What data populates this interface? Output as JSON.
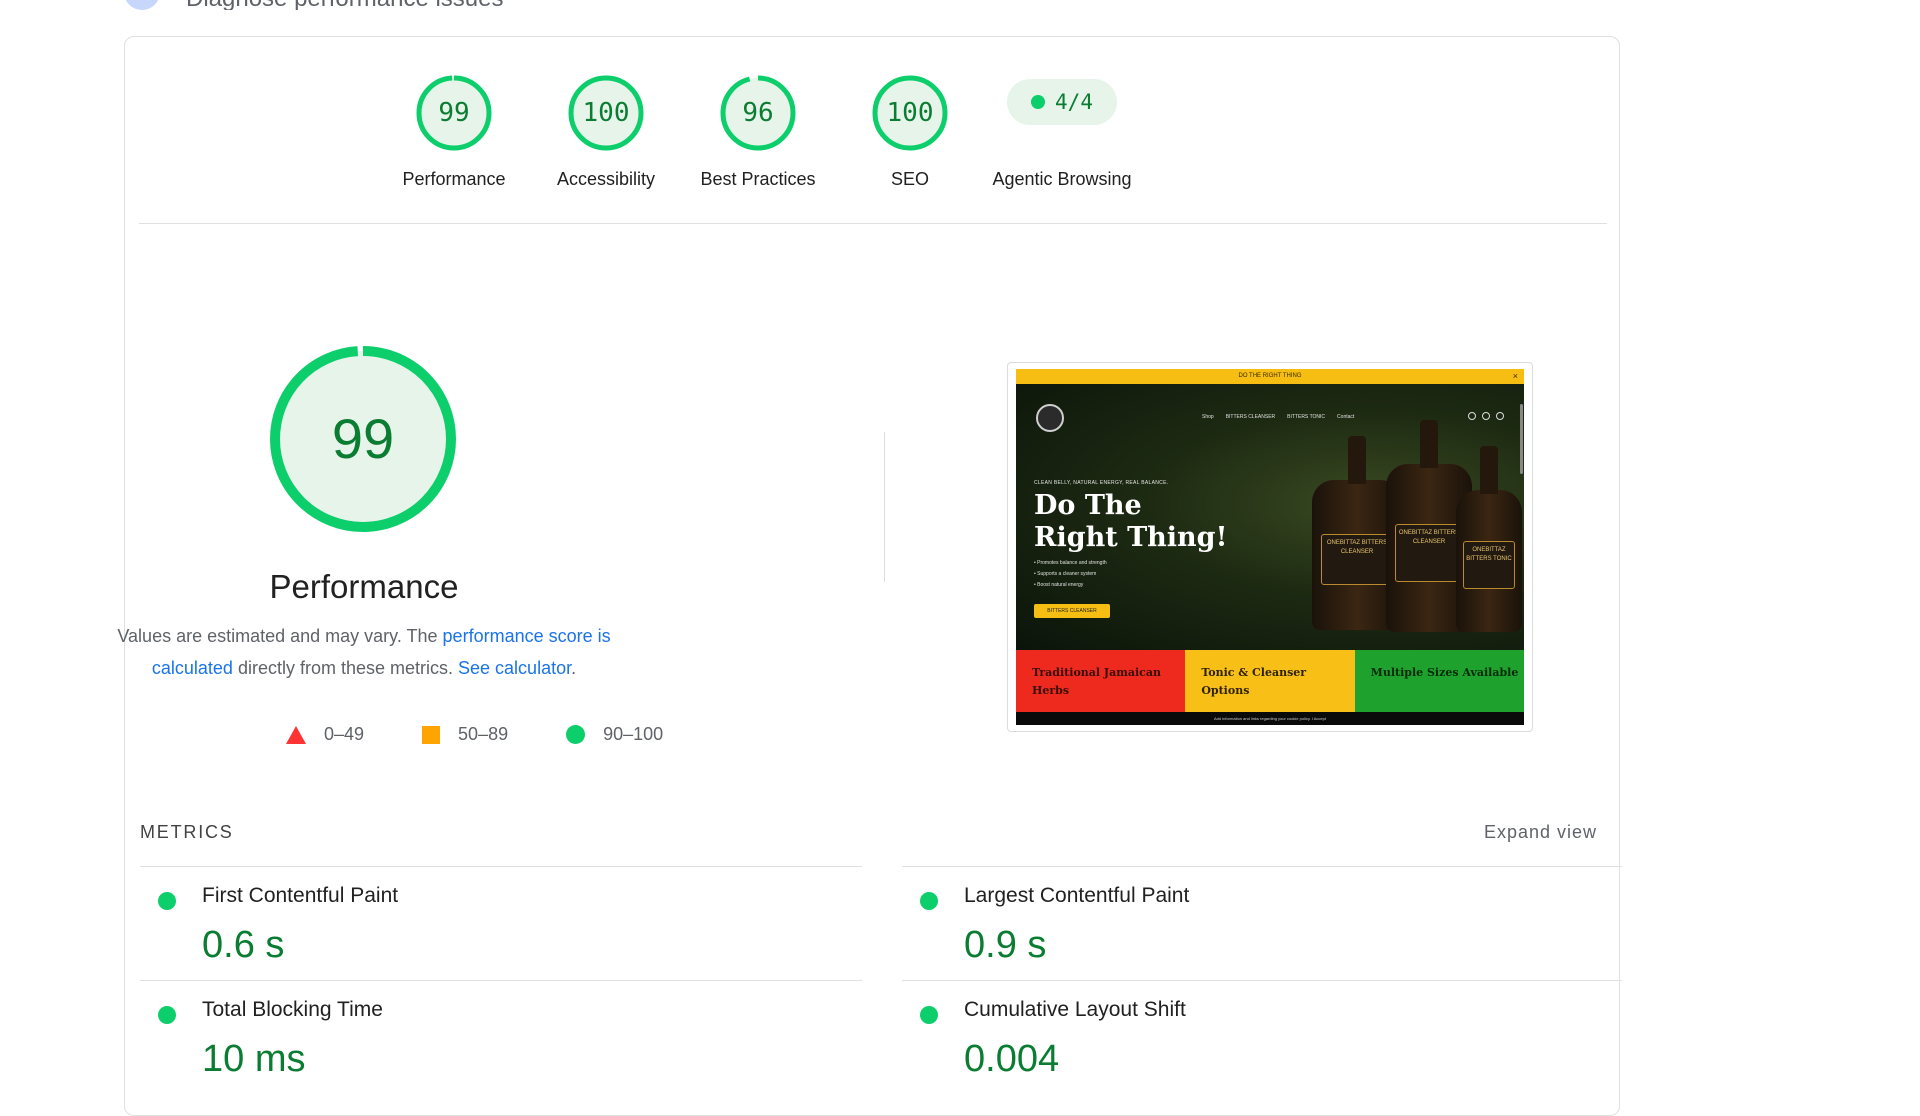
{
  "header": {
    "title": "Diagnose performance issues"
  },
  "colors": {
    "pass": "#0cce6b",
    "pass_text": "#0a7d32",
    "pass_bg": "#e6f4ea",
    "average": "#ffa400",
    "fail": "#ff3333",
    "link": "#1a73e8"
  },
  "gauges": [
    {
      "score": "99",
      "label": "Performance",
      "value": 99
    },
    {
      "score": "100",
      "label": "Accessibility",
      "value": 100
    },
    {
      "score": "96",
      "label": "Best Practices",
      "value": 96
    },
    {
      "score": "100",
      "label": "SEO",
      "value": 100
    }
  ],
  "agentic": {
    "score": "4/4",
    "label": "Agentic Browsing"
  },
  "performance": {
    "score": "99",
    "value": 99,
    "title": "Performance",
    "desc_prefix": "Values are estimated and may vary. The ",
    "link1": "performance score is calculated",
    "desc_middle": " directly from these metrics. ",
    "link2": "See calculator",
    "desc_suffix": "."
  },
  "legend": {
    "fail": "0–49",
    "average": "50–89",
    "pass": "90–100"
  },
  "screenshot": {
    "announcement": "DO THE RIGHT THING",
    "close": "×",
    "nav": [
      "Shop",
      "BITTERS CLEANSER",
      "BITTERS TONIC",
      "Contact"
    ],
    "eyebrow": "CLEAN BELLY, NATURAL ENERGY, REAL BALANCE.",
    "headline": "Do The Right Thing!",
    "bullets": [
      "• Promotes balance and strength",
      "• Supports a cleaner system",
      "• Boost natural energy"
    ],
    "cta": "BITTERS CLEANSER",
    "bottles": [
      "ONEBITTAZ BITTERS CLEANSER",
      "ONEBITTAZ BITTERS CLEANSER",
      "ONEBITTAZ BITTERS TONIC"
    ],
    "bands": [
      "Traditional Jamaican Herbs",
      "Tonic & Cleanser Options",
      "Multiple Sizes Available"
    ],
    "cookie": "Add information and links regarding your cookie policy.  I Accept"
  },
  "metrics": {
    "heading": "METRICS",
    "expand": "Expand view",
    "items": [
      {
        "name": "First Contentful Paint",
        "value": "0.6 s"
      },
      {
        "name": "Largest Contentful Paint",
        "value": "0.9 s"
      },
      {
        "name": "Total Blocking Time",
        "value": "10 ms"
      },
      {
        "name": "Cumulative Layout Shift",
        "value": "0.004"
      }
    ]
  }
}
